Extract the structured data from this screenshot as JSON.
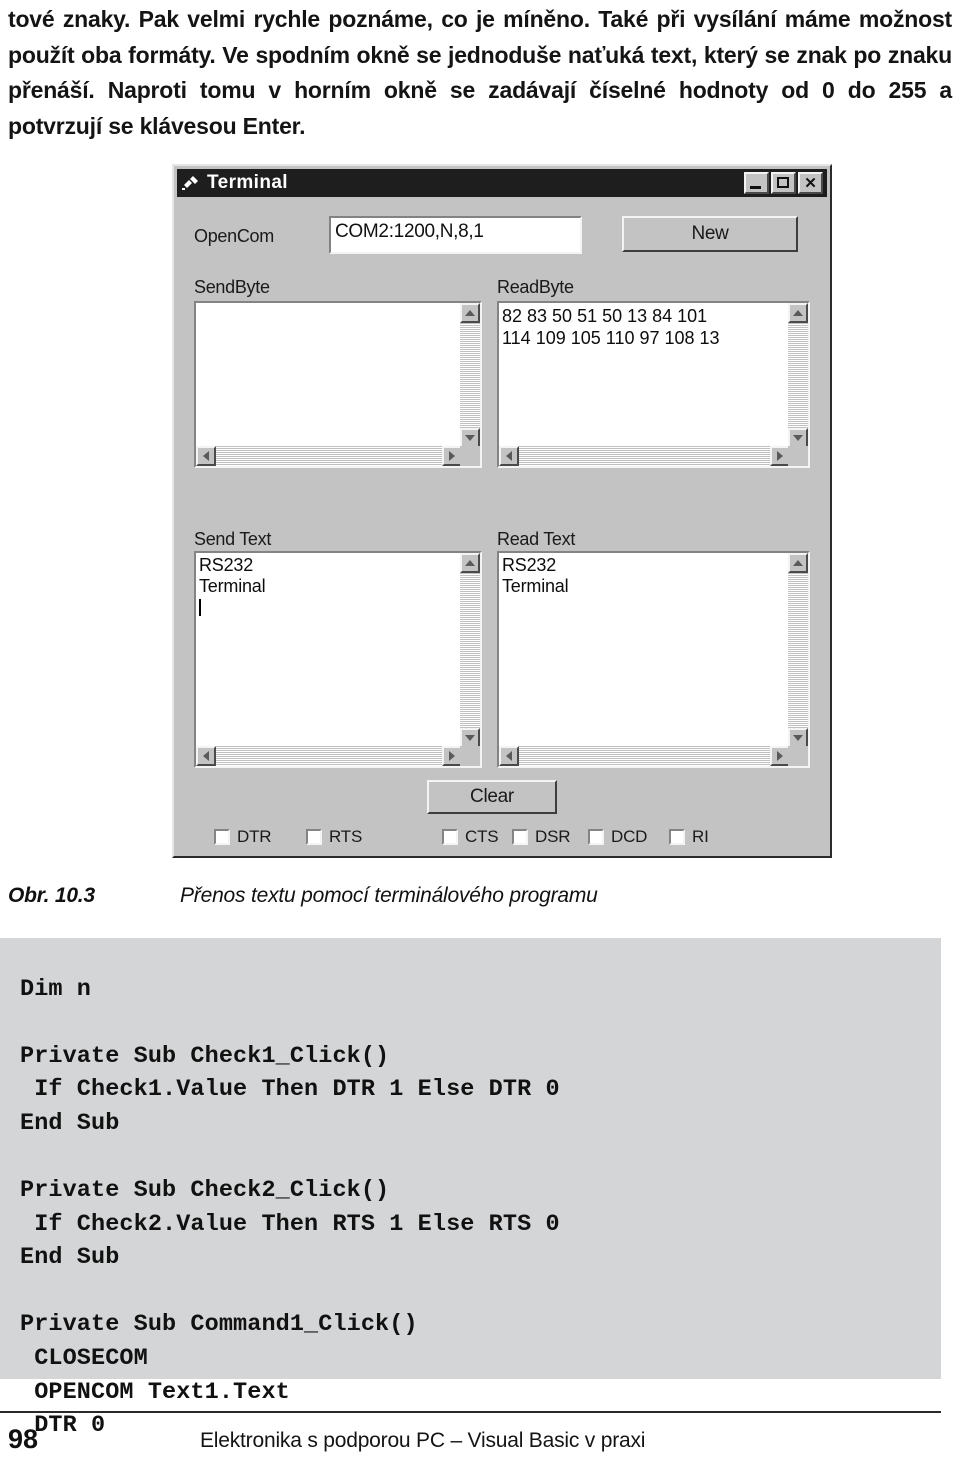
{
  "document": {
    "paragraph": "tové znaky. Pak velmi rychle poznáme, co je míněno. Také při vysílání máme možnost použít oba formáty. Ve spodním okně se jednoduše naťuká text, který se znak po znaku přenáší. Naproti tomu v horním okně se zadávají číselné hodnoty od 0 do 255 a potvrzují se klávesou Enter.",
    "caption_number": "Obr. 10.3",
    "caption_text": "Přenos textu pomocí terminálového programu",
    "code": "Dim n\n\nPrivate Sub Check1_Click()\n If Check1.Value Then DTR 1 Else DTR 0\nEnd Sub\n\nPrivate Sub Check2_Click()\n If Check2.Value Then RTS 1 Else RTS 0\nEnd Sub\n\nPrivate Sub Command1_Click()\n CLOSECOM\n OPENCOM Text1.Text\n DTR 0",
    "footer_page": "98",
    "footer_text": "Elektronika s podporou PC – Visual Basic v praxi"
  },
  "terminal_window": {
    "title": "Terminal",
    "title_icon": "terminal-plug-icon",
    "titlebar_buttons": {
      "minimize": "minimize-icon",
      "maximize": "maximize-icon",
      "close": "close-icon"
    },
    "opencom": {
      "label": "OpenCom",
      "value": "COM2:1200,N,8,1",
      "placeholder": "COM2:1200,N,8,1"
    },
    "new_button": "New",
    "send_byte": {
      "label": "SendByte",
      "value": ""
    },
    "read_byte": {
      "label": "ReadByte",
      "value": "82 83 50 51 50 13 84 101\n114 109 105 110 97 108 13"
    },
    "send_text": {
      "label": "Send Text",
      "value": "RS232\nTerminal"
    },
    "read_text": {
      "label": "Read Text",
      "value": "RS232\nTerminal"
    },
    "clear_button": "Clear",
    "checkboxes": [
      {
        "label": "DTR",
        "checked": false
      },
      {
        "label": "RTS",
        "checked": false
      },
      {
        "label": "CTS",
        "checked": false
      },
      {
        "label": "DSR",
        "checked": false
      },
      {
        "label": "DCD",
        "checked": false
      },
      {
        "label": "RI",
        "checked": false
      }
    ],
    "scrollbar_icons": {
      "up": "scroll-up-arrow-icon",
      "down": "scroll-down-arrow-icon",
      "left": "scroll-left-arrow-icon",
      "right": "scroll-right-arrow-icon"
    }
  },
  "colors": {
    "window_face": "#c3c3c3",
    "titlebar": "#1e1e1e",
    "code_background": "#d4d5d6",
    "page_background": "#ffffff"
  }
}
